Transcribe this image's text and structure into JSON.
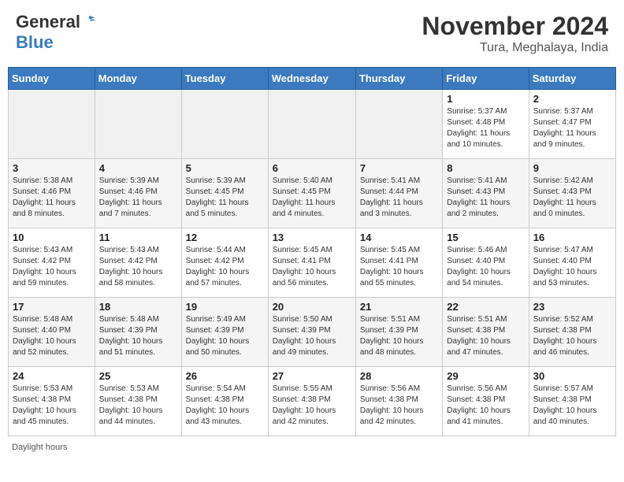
{
  "header": {
    "logo_general": "General",
    "logo_blue": "Blue",
    "month_title": "November 2024",
    "location": "Tura, Meghalaya, India"
  },
  "days_of_week": [
    "Sunday",
    "Monday",
    "Tuesday",
    "Wednesday",
    "Thursday",
    "Friday",
    "Saturday"
  ],
  "footer": {
    "daylight_hours": "Daylight hours"
  },
  "weeks": [
    [
      {
        "day": "",
        "info": ""
      },
      {
        "day": "",
        "info": ""
      },
      {
        "day": "",
        "info": ""
      },
      {
        "day": "",
        "info": ""
      },
      {
        "day": "",
        "info": ""
      },
      {
        "day": "1",
        "info": "Sunrise: 5:37 AM\nSunset: 4:48 PM\nDaylight: 11 hours\nand 10 minutes."
      },
      {
        "day": "2",
        "info": "Sunrise: 5:37 AM\nSunset: 4:47 PM\nDaylight: 11 hours\nand 9 minutes."
      }
    ],
    [
      {
        "day": "3",
        "info": "Sunrise: 5:38 AM\nSunset: 4:46 PM\nDaylight: 11 hours\nand 8 minutes."
      },
      {
        "day": "4",
        "info": "Sunrise: 5:39 AM\nSunset: 4:46 PM\nDaylight: 11 hours\nand 7 minutes."
      },
      {
        "day": "5",
        "info": "Sunrise: 5:39 AM\nSunset: 4:45 PM\nDaylight: 11 hours\nand 5 minutes."
      },
      {
        "day": "6",
        "info": "Sunrise: 5:40 AM\nSunset: 4:45 PM\nDaylight: 11 hours\nand 4 minutes."
      },
      {
        "day": "7",
        "info": "Sunrise: 5:41 AM\nSunset: 4:44 PM\nDaylight: 11 hours\nand 3 minutes."
      },
      {
        "day": "8",
        "info": "Sunrise: 5:41 AM\nSunset: 4:43 PM\nDaylight: 11 hours\nand 2 minutes."
      },
      {
        "day": "9",
        "info": "Sunrise: 5:42 AM\nSunset: 4:43 PM\nDaylight: 11 hours\nand 0 minutes."
      }
    ],
    [
      {
        "day": "10",
        "info": "Sunrise: 5:43 AM\nSunset: 4:42 PM\nDaylight: 10 hours\nand 59 minutes."
      },
      {
        "day": "11",
        "info": "Sunrise: 5:43 AM\nSunset: 4:42 PM\nDaylight: 10 hours\nand 58 minutes."
      },
      {
        "day": "12",
        "info": "Sunrise: 5:44 AM\nSunset: 4:42 PM\nDaylight: 10 hours\nand 57 minutes."
      },
      {
        "day": "13",
        "info": "Sunrise: 5:45 AM\nSunset: 4:41 PM\nDaylight: 10 hours\nand 56 minutes."
      },
      {
        "day": "14",
        "info": "Sunrise: 5:45 AM\nSunset: 4:41 PM\nDaylight: 10 hours\nand 55 minutes."
      },
      {
        "day": "15",
        "info": "Sunrise: 5:46 AM\nSunset: 4:40 PM\nDaylight: 10 hours\nand 54 minutes."
      },
      {
        "day": "16",
        "info": "Sunrise: 5:47 AM\nSunset: 4:40 PM\nDaylight: 10 hours\nand 53 minutes."
      }
    ],
    [
      {
        "day": "17",
        "info": "Sunrise: 5:48 AM\nSunset: 4:40 PM\nDaylight: 10 hours\nand 52 minutes."
      },
      {
        "day": "18",
        "info": "Sunrise: 5:48 AM\nSunset: 4:39 PM\nDaylight: 10 hours\nand 51 minutes."
      },
      {
        "day": "19",
        "info": "Sunrise: 5:49 AM\nSunset: 4:39 PM\nDaylight: 10 hours\nand 50 minutes."
      },
      {
        "day": "20",
        "info": "Sunrise: 5:50 AM\nSunset: 4:39 PM\nDaylight: 10 hours\nand 49 minutes."
      },
      {
        "day": "21",
        "info": "Sunrise: 5:51 AM\nSunset: 4:39 PM\nDaylight: 10 hours\nand 48 minutes."
      },
      {
        "day": "22",
        "info": "Sunrise: 5:51 AM\nSunset: 4:38 PM\nDaylight: 10 hours\nand 47 minutes."
      },
      {
        "day": "23",
        "info": "Sunrise: 5:52 AM\nSunset: 4:38 PM\nDaylight: 10 hours\nand 46 minutes."
      }
    ],
    [
      {
        "day": "24",
        "info": "Sunrise: 5:53 AM\nSunset: 4:38 PM\nDaylight: 10 hours\nand 45 minutes."
      },
      {
        "day": "25",
        "info": "Sunrise: 5:53 AM\nSunset: 4:38 PM\nDaylight: 10 hours\nand 44 minutes."
      },
      {
        "day": "26",
        "info": "Sunrise: 5:54 AM\nSunset: 4:38 PM\nDaylight: 10 hours\nand 43 minutes."
      },
      {
        "day": "27",
        "info": "Sunrise: 5:55 AM\nSunset: 4:38 PM\nDaylight: 10 hours\nand 42 minutes."
      },
      {
        "day": "28",
        "info": "Sunrise: 5:56 AM\nSunset: 4:38 PM\nDaylight: 10 hours\nand 42 minutes."
      },
      {
        "day": "29",
        "info": "Sunrise: 5:56 AM\nSunset: 4:38 PM\nDaylight: 10 hours\nand 41 minutes."
      },
      {
        "day": "30",
        "info": "Sunrise: 5:57 AM\nSunset: 4:38 PM\nDaylight: 10 hours\nand 40 minutes."
      }
    ]
  ]
}
